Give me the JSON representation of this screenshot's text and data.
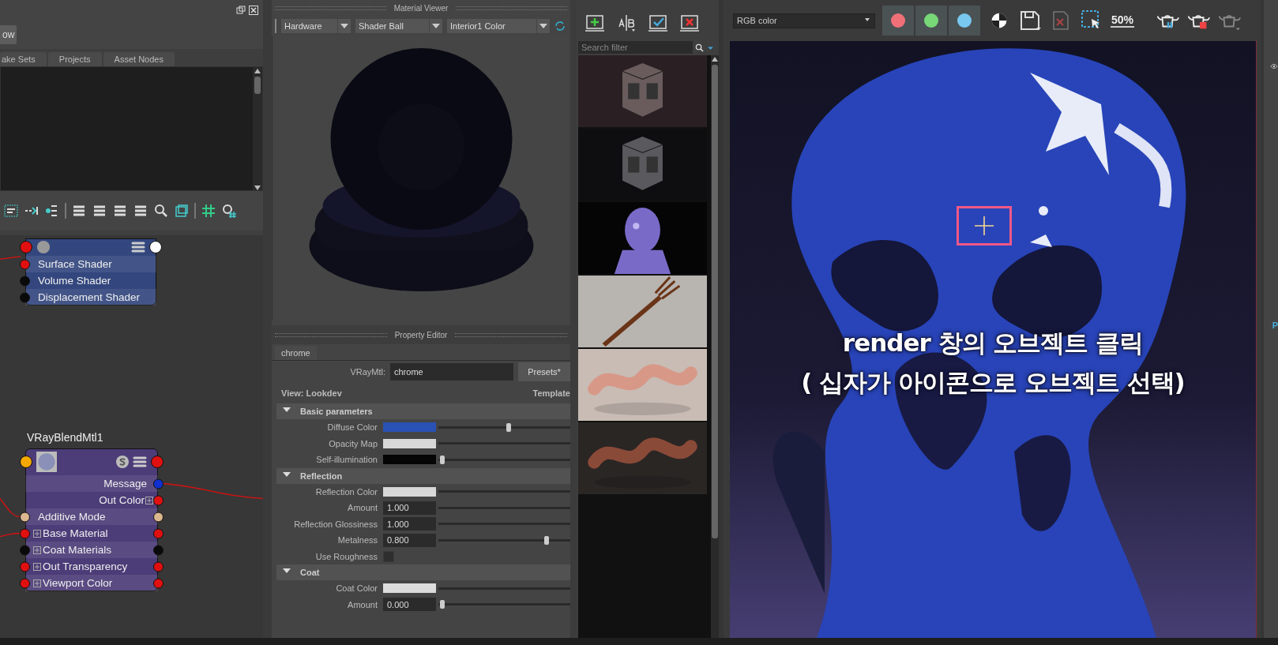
{
  "left_panel": {
    "button": "ow",
    "tabs": [
      {
        "label": "ake Sets",
        "selected": false
      },
      {
        "label": "Projects",
        "selected": false
      },
      {
        "label": "Asset Nodes",
        "selected": false
      }
    ]
  },
  "node_editor": {
    "nodes": [
      {
        "kind": "shading",
        "header": {
          "input": {
            "color": "#e01010"
          },
          "output": {
            "color": "#ffffff"
          }
        },
        "rows": [
          {
            "kind": "input",
            "label": "Surface Shader",
            "expandable": false,
            "input": {
              "color": "#e01010"
            }
          },
          {
            "kind": "input",
            "label": "Volume Shader",
            "expandable": false,
            "input": {
              "color": "#0a0a0a"
            }
          },
          {
            "kind": "input",
            "label": "Displacement Shader",
            "expandable": false,
            "input": {
              "color": "#0a0a0a"
            }
          }
        ]
      },
      {
        "kind": "material",
        "title": "VRayBlendMtl1",
        "header": {
          "input": {
            "color": "#f5a800"
          },
          "output": {
            "color": "#e01010"
          }
        },
        "rows": [
          {
            "kind": "output",
            "label": "Message",
            "expandable": false,
            "output": {
              "color": "#1030d0"
            }
          },
          {
            "kind": "output",
            "label": "Out Color",
            "expandable": true,
            "output": {
              "color": "#e01010"
            }
          },
          {
            "kind": "both",
            "label": "Additive Mode",
            "expandable": false,
            "input": {
              "color": "#dcb890"
            },
            "output": {
              "color": "#dcb890"
            }
          },
          {
            "kind": "both",
            "label": "Base Material",
            "expandable": true,
            "input": {
              "color": "#e01010"
            },
            "output": {
              "color": "#e01010"
            }
          },
          {
            "kind": "both",
            "label": "Coat Materials",
            "expandable": true,
            "input": {
              "color": "#0a0a0a"
            },
            "output": {
              "color": "#0a0a0a"
            }
          },
          {
            "kind": "both",
            "label": "Out Transparency",
            "expandable": true,
            "input": {
              "color": "#e01010"
            },
            "output": {
              "color": "#e01010"
            }
          },
          {
            "kind": "both",
            "label": "Viewport Color",
            "expandable": true,
            "input": {
              "color": "#e01010"
            },
            "output": {
              "color": "#e01010"
            }
          }
        ]
      }
    ]
  },
  "material_viewer": {
    "title": "Material Viewer",
    "dropdowns": [
      "Hardware",
      "Shader Ball",
      "Interior1 Color"
    ],
    "kind": "picture"
  },
  "property_editor": {
    "title": "Property Editor",
    "tab": "chrome",
    "type_label": "VRayMtl:",
    "name": "chrome",
    "presets": "Presets*",
    "view": "View: Lookdev",
    "template": "Template",
    "sections": [
      {
        "title": "Basic parameters",
        "expanded": true,
        "rows": [
          {
            "kind": "color",
            "label": "Diffuse Color",
            "color": "#2a52b4",
            "level": 0.53
          },
          {
            "kind": "color",
            "label": "Opacity Map",
            "color": "#d8d8d8"
          },
          {
            "kind": "color",
            "label": "Self-illumination",
            "color": "#050505",
            "level": 0.03
          }
        ]
      },
      {
        "title": "Reflection",
        "expanded": true,
        "rows": [
          {
            "kind": "color",
            "label": "Reflection Color",
            "color": "#d8d8d8"
          },
          {
            "kind": "number",
            "label": "Amount",
            "value": "1.000"
          },
          {
            "kind": "number",
            "label": "Reflection Glossiness",
            "value": "1.000"
          },
          {
            "kind": "number",
            "label": "Metalness",
            "value": "0.800",
            "level": 0.82
          },
          {
            "kind": "checkbox",
            "label": "Use Roughness",
            "checked": false
          }
        ]
      },
      {
        "title": "Coat",
        "expanded": true,
        "rows": [
          {
            "kind": "color",
            "label": "Coat Color",
            "color": "#dcdcdc"
          },
          {
            "kind": "number",
            "label": "Amount",
            "value": "0.000",
            "level": 0.03
          }
        ]
      }
    ]
  },
  "history": {
    "search": {
      "placeholder": "Search filter"
    }
  },
  "render_view": {
    "channel": "RGB color",
    "channels": [
      {
        "color": "#f07078"
      },
      {
        "color": "#78d878"
      },
      {
        "color": "#78c8f0"
      }
    ],
    "zoom": "50%",
    "kind": "picture",
    "caption": [
      "render 창의 오브젝트 클릭",
      "( 십자가 아이콘으로 오브젝트 선택)"
    ]
  },
  "right_strip": {
    "label": "P"
  }
}
